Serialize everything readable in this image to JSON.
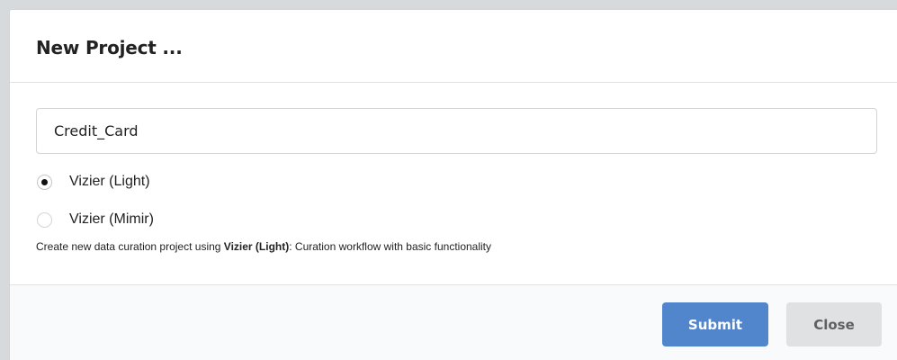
{
  "modal": {
    "title": "New Project ..."
  },
  "form": {
    "project_name_value": "Credit_Card",
    "engine_options": [
      {
        "label": "Vizier (Light)",
        "selected": true
      },
      {
        "label": "Vizier (Mimir)",
        "selected": false
      }
    ],
    "description": {
      "prefix": "Create new data curation project using ",
      "engine_name": "Vizier (Light)",
      "suffix": ": Curation workflow with basic functionality"
    }
  },
  "actions": {
    "submit_label": "Submit",
    "close_label": "Close"
  },
  "colors": {
    "submit_bg": "#5185cc",
    "close_bg": "#e0e1e2"
  }
}
